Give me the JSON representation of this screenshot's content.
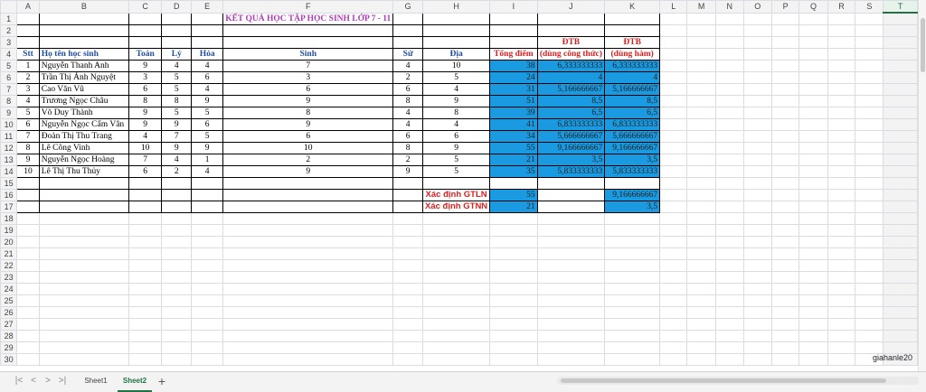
{
  "columns": [
    "A",
    "B",
    "C",
    "D",
    "E",
    "F",
    "G",
    "H",
    "I",
    "J",
    "K",
    "L",
    "M",
    "N",
    "O",
    "P",
    "Q",
    "R",
    "S",
    "T"
  ],
  "selected_column": "T",
  "title": "KẾT QUẢ HỌC TẬP HỌC SINH LỚP 7 - 11",
  "header_dtb1": "ĐTB",
  "header_dtb2": "ĐTB",
  "headers": {
    "stt": "Stt",
    "name": "Họ tên học sinh",
    "toan": "Toán",
    "ly": "Lý",
    "hoa": "Hóa",
    "sinh": "Sinh",
    "su": "Sử",
    "dia": "Địa",
    "tong": "Tổng điểm",
    "dtb_ct": "(dùng công thức)",
    "dtb_ham": "(dùng hàm)"
  },
  "students": [
    {
      "stt": "1",
      "name": "Nguyễn Thanh Anh",
      "toan": "9",
      "ly": "4",
      "hoa": "4",
      "sinh": "7",
      "su": "4",
      "dia": "10",
      "tong": "38",
      "dtb_ct": "6,333333333",
      "dtb_ham": "6,333333333"
    },
    {
      "stt": "2",
      "name": "Trần Thị Ánh Nguyệt",
      "toan": "3",
      "ly": "5",
      "hoa": "6",
      "sinh": "3",
      "su": "2",
      "dia": "5",
      "tong": "24",
      "dtb_ct": "4",
      "dtb_ham": "4"
    },
    {
      "stt": "3",
      "name": "Cao Văn Vũ",
      "toan": "6",
      "ly": "5",
      "hoa": "4",
      "sinh": "6",
      "su": "6",
      "dia": "4",
      "tong": "31",
      "dtb_ct": "5,166666667",
      "dtb_ham": "5,166666667"
    },
    {
      "stt": "4",
      "name": "Trương Ngọc Châu",
      "toan": "8",
      "ly": "8",
      "hoa": "9",
      "sinh": "9",
      "su": "8",
      "dia": "9",
      "tong": "51",
      "dtb_ct": "8,5",
      "dtb_ham": "8,5"
    },
    {
      "stt": "5",
      "name": "Võ Duy Thành",
      "toan": "9",
      "ly": "5",
      "hoa": "5",
      "sinh": "8",
      "su": "4",
      "dia": "8",
      "tong": "39",
      "dtb_ct": "6,5",
      "dtb_ham": "6,5"
    },
    {
      "stt": "6",
      "name": "Nguyễn Ngọc Cẩm Vân",
      "toan": "9",
      "ly": "9",
      "hoa": "6",
      "sinh": "9",
      "su": "4",
      "dia": "4",
      "tong": "41",
      "dtb_ct": "6,833333333",
      "dtb_ham": "6,833333333"
    },
    {
      "stt": "7",
      "name": "Đoàn Thị Thu Trang",
      "toan": "4",
      "ly": "7",
      "hoa": "5",
      "sinh": "6",
      "su": "6",
      "dia": "6",
      "tong": "34",
      "dtb_ct": "5,666666667",
      "dtb_ham": "5,666666667"
    },
    {
      "stt": "8",
      "name": "Lê Công Vinh",
      "toan": "10",
      "ly": "9",
      "hoa": "9",
      "sinh": "10",
      "su": "8",
      "dia": "9",
      "tong": "55",
      "dtb_ct": "9,166666667",
      "dtb_ham": "9,166666667"
    },
    {
      "stt": "9",
      "name": "Nguyễn Ngọc Hoàng",
      "toan": "7",
      "ly": "4",
      "hoa": "1",
      "sinh": "2",
      "su": "2",
      "dia": "5",
      "tong": "21",
      "dtb_ct": "3,5",
      "dtb_ham": "3,5"
    },
    {
      "stt": "10",
      "name": "Lê Thị Thu Thủy",
      "toan": "6",
      "ly": "2",
      "hoa": "4",
      "sinh": "9",
      "su": "9",
      "dia": "5",
      "tong": "35",
      "dtb_ct": "5,833333333",
      "dtb_ham": "5,833333333"
    }
  ],
  "gtln": {
    "label": "Xác định GTLN",
    "tong": "55",
    "dtb_ham": "9,166666667"
  },
  "gtnn": {
    "label": "Xác định GTNN",
    "tong": "21",
    "dtb_ham": "3,5"
  },
  "tabs": [
    "Sheet1",
    "Sheet2"
  ],
  "active_tab": "Sheet2",
  "watermark": "giahanle20",
  "colors": {
    "accent": "#217346",
    "fill": "#1a9ae0",
    "title": "#b03ab8",
    "header": "#1f4e9c",
    "red": "#d92020"
  }
}
